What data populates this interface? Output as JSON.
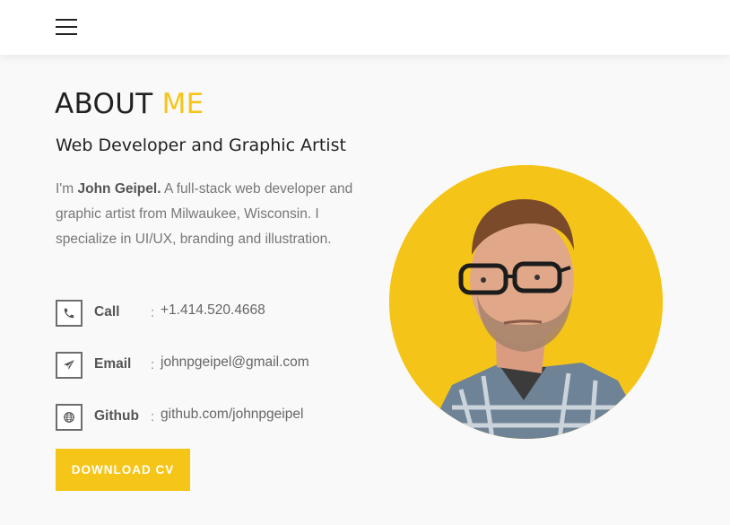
{
  "header": {
    "menu_icon": "hamburger-menu-icon"
  },
  "about": {
    "title_main": "ABOUT",
    "title_accent": "ME",
    "subtitle": "Web Developer and Graphic Artist",
    "bio_prefix": "I'm ",
    "bio_name": "John Geipel.",
    "bio_rest": " A full-stack web developer and graphic artist from Milwaukee, Wisconsin. I specialize in UI/UX, branding and illustration."
  },
  "contacts": [
    {
      "icon": "phone-icon",
      "label": "Call",
      "separator": ":",
      "value": "+1.414.520.4668"
    },
    {
      "icon": "paper-plane-icon",
      "label": "Email",
      "separator": ":",
      "value": "johnpgeipel@gmail.com"
    },
    {
      "icon": "globe-icon",
      "label": "Github",
      "separator": ":",
      "value": "github.com/johnpgeipel"
    }
  ],
  "download_button": {
    "label": "DOWNLOAD CV"
  },
  "colors": {
    "accent": "#f5c518",
    "heading": "#212121",
    "body_text": "#777777"
  }
}
